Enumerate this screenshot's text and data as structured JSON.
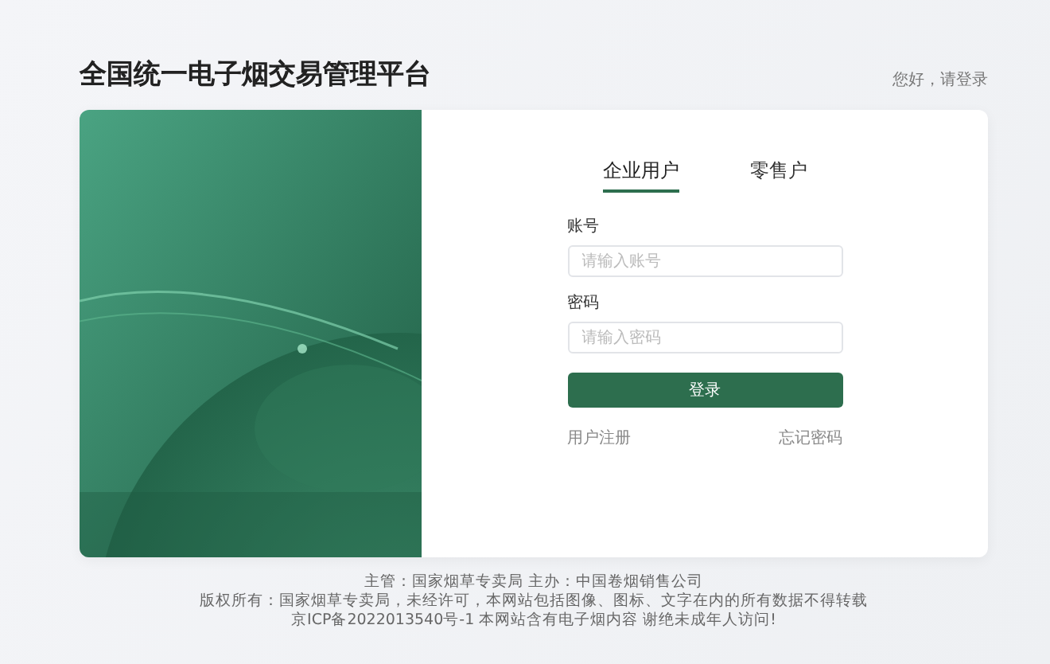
{
  "header": {
    "title": "全国统一电子烟交易管理平台",
    "greeting": "您好，请登录"
  },
  "login": {
    "tabs": [
      {
        "label": "企业用户",
        "selected": true
      },
      {
        "label": "零售户",
        "selected": false
      }
    ],
    "fields": [
      {
        "label": "账号",
        "placeholder": "请输入账号"
      },
      {
        "label": "密码",
        "placeholder": "请输入密码"
      }
    ],
    "submit": "登录",
    "register": "用户注册",
    "forgot": "忘记密码"
  },
  "footer": [
    "主管：国家烟草专卖局 主办：中国卷烟销售公司",
    "版权所有：国家烟草专卖局，未经许可，本网站包括图像、图标、文字在内的所有数据不得转载",
    "京ICP备2022013540号-1 本网站含有电子烟内容 谢绝未成年人访问!"
  ]
}
